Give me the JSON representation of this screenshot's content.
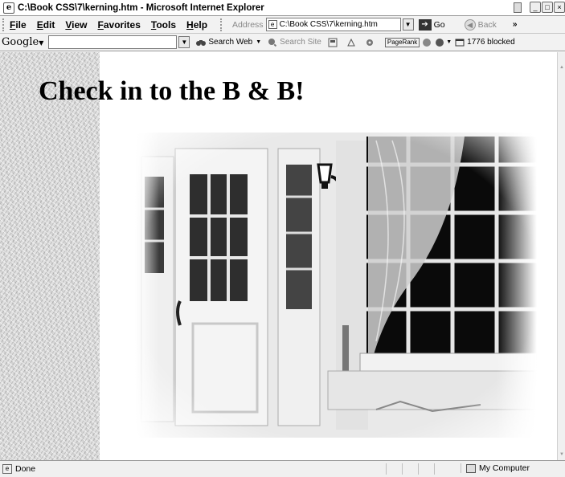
{
  "window": {
    "title": "C:\\Book CSS\\7\\kerning.htm - Microsoft Internet Explorer",
    "controls": [
      "minimize",
      "maximize",
      "close"
    ]
  },
  "menu": {
    "items": [
      "File",
      "Edit",
      "View",
      "Favorites",
      "Tools",
      "Help"
    ],
    "address_label": "Address",
    "address_value": "C:\\Book CSS\\7\\kerning.htm",
    "go_label": "Go",
    "back_label": "Back",
    "chevron": "»"
  },
  "google_toolbar": {
    "logo": "Google",
    "search_value": "",
    "search_web": "Search Web",
    "search_site": "Search Site",
    "pagerank": "PageRank",
    "popups_blocked": "1776 blocked"
  },
  "page": {
    "heading": "Check in to the B & B!",
    "photo_icon": "inn-doorway-photo",
    "background_icon": "stucco-texture"
  },
  "status": {
    "text": "Done",
    "zone": "My Computer"
  }
}
